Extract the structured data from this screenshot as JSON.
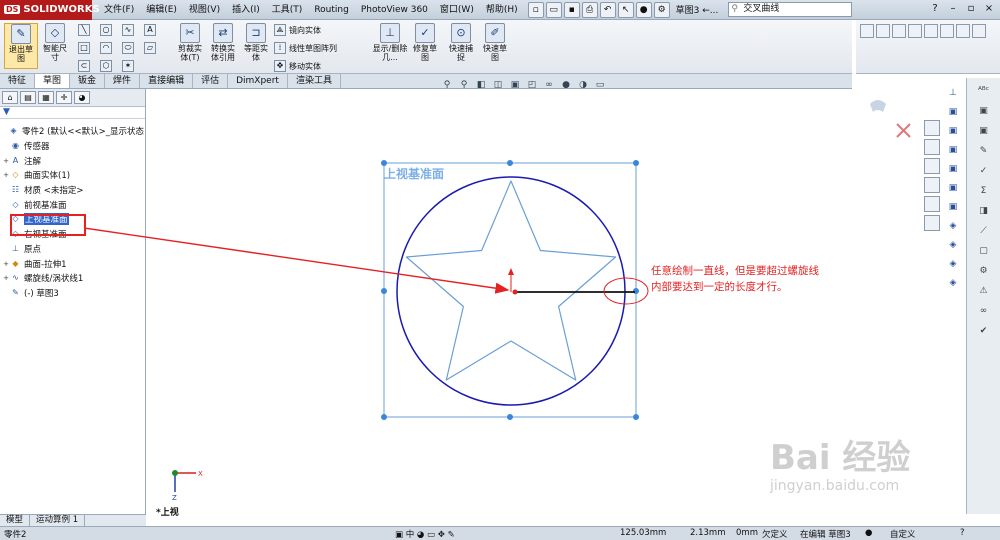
{
  "app": {
    "logo": "SOLIDWORKS",
    "logo_badge": "DS",
    "document": "草图3 ←...",
    "search_value": "交叉曲线"
  },
  "menu": [
    "文件(F)",
    "编辑(E)",
    "视图(V)",
    "插入(I)",
    "工具(T)",
    "Routing",
    "PhotoView 360",
    "窗口(W)",
    "帮助(H)"
  ],
  "ribbon": {
    "exit_sketch": "退出草图",
    "smart_dim": "智能尺寸",
    "trim": "剪裁实体(T)",
    "convert": "转换实体引用",
    "offset": "等距实体",
    "mirror": "镜向实体",
    "linear_pattern": "线性草图阵列",
    "move": "移动实体",
    "display_delete": "显示/删除几...",
    "repair": "修复草图",
    "quick_snap": "快速捕捉",
    "rapid_sketch": "快速草图"
  },
  "tabs": [
    "特征",
    "草图",
    "钣金",
    "焊件",
    "直接编辑",
    "评估",
    "DimXpert",
    "渲染工具"
  ],
  "active_tab": "草图",
  "tree": [
    {
      "label": "零件2 (默认<<默认>_显示状态",
      "icon": "part-icon",
      "exp": ""
    },
    {
      "label": "传感器",
      "icon": "sensor-icon",
      "exp": ""
    },
    {
      "label": "注解",
      "icon": "annotation-icon",
      "exp": "+"
    },
    {
      "label": "曲面实体(1)",
      "icon": "surface-body-icon",
      "exp": "+"
    },
    {
      "label": "材质 <未指定>",
      "icon": "material-icon",
      "exp": ""
    },
    {
      "label": "前视基准面",
      "icon": "plane-icon",
      "exp": ""
    },
    {
      "label": "上视基准面",
      "icon": "plane-icon",
      "exp": "",
      "highlight": true
    },
    {
      "label": "右视基准面",
      "icon": "plane-icon",
      "exp": ""
    },
    {
      "label": "原点",
      "icon": "origin-icon",
      "exp": ""
    },
    {
      "label": "曲面-拉伸1",
      "icon": "extrude-icon",
      "exp": "+"
    },
    {
      "label": "螺旋线/涡状线1",
      "icon": "helix-icon",
      "exp": "+"
    },
    {
      "label": "(-) 草图3",
      "icon": "sketch-icon",
      "exp": ""
    }
  ],
  "bottom_tabs": [
    "模型",
    "运动算例 1"
  ],
  "canvas": {
    "plane_label": "上视基准面",
    "view_label": "*上视",
    "annotation_line1": "任意绘制一直线，但是要超过螺旋线",
    "annotation_line2": "内部要达到一定的长度才行。",
    "axis_x": "X",
    "axis_z": "Z"
  },
  "status": {
    "part": "零件2",
    "x": "125.03mm",
    "y": "2.13mm",
    "z": "0mm",
    "state": "欠定义",
    "editing": "在编辑 草图3",
    "custom": "自定义"
  },
  "watermark": {
    "main": "Bai 经验",
    "url": "jingyan.baidu.com"
  },
  "colors": {
    "sketch_blue": "#6a9fd6",
    "circle_blue": "#1a1ab0",
    "annotation_red": "#e42222",
    "highlight": "#3266cc"
  }
}
